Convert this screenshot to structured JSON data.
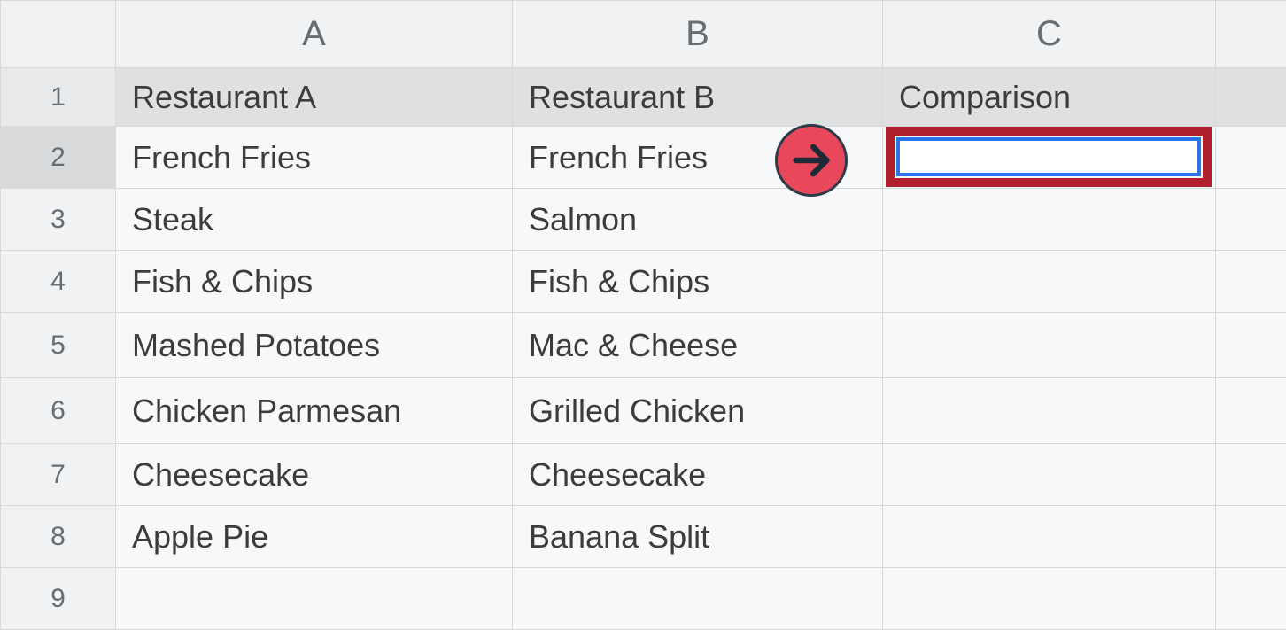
{
  "columns": {
    "a": "A",
    "b": "B",
    "c": "C"
  },
  "row_labels": {
    "r1": "1",
    "r2": "2",
    "r3": "3",
    "r4": "4",
    "r5": "5",
    "r6": "6",
    "r7": "7",
    "r8": "8",
    "r9": "9"
  },
  "header": {
    "a": "Restaurant A",
    "b": "Restaurant B",
    "c": "Comparison"
  },
  "rows": [
    {
      "a": "French Fries",
      "b": "French Fries",
      "c": ""
    },
    {
      "a": "Steak",
      "b": "Salmon",
      "c": ""
    },
    {
      "a": "Fish & Chips",
      "b": "Fish & Chips",
      "c": ""
    },
    {
      "a": "Mashed Potatoes",
      "b": "Mac & Cheese",
      "c": ""
    },
    {
      "a": "Chicken Parmesan",
      "b": "Grilled Chicken",
      "c": ""
    },
    {
      "a": "Cheesecake",
      "b": "Cheesecake",
      "c": ""
    },
    {
      "a": "Apple Pie",
      "b": "Banana Split",
      "c": ""
    }
  ],
  "active_cell": {
    "ref": "C2",
    "value": ""
  },
  "annotation": {
    "icon": "arrow-right"
  }
}
